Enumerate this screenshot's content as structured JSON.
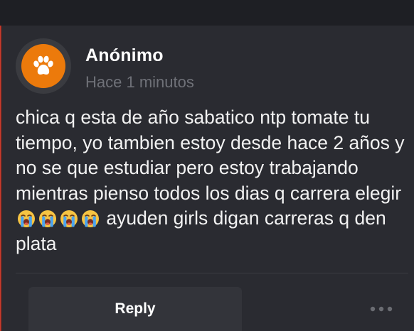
{
  "post": {
    "author": "Anónimo",
    "timestamp": "Hace 1 minutos",
    "body_line1_a": "chica q esta de año sabatico ntp tomate tu tiempo, yo tambien estoy desde hace 2 años y no se que estudiar pero estoy trabajando mientras pienso todos los dias q carrera elegir",
    "body_line1_b": "ayuden girls digan carreras q den plata",
    "emoji_name": "loudly-crying-face",
    "emoji_count": 4,
    "avatar_icon": "paw-icon"
  },
  "actions": {
    "reply_label": "Reply",
    "more_icon": "more-horizontal-icon"
  },
  "colors": {
    "background": "#1e1f24",
    "card": "#2a2b31",
    "avatar_accent": "#ec7a0b",
    "timestamp": "#6f7178"
  }
}
